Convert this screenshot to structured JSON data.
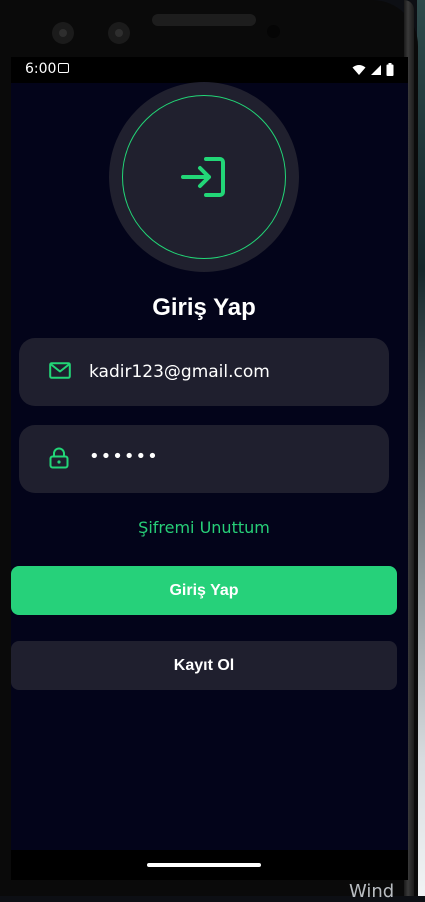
{
  "status_bar": {
    "time": "6:00",
    "icons": [
      "screenshot-icon",
      "wifi-icon",
      "signal-icon",
      "battery-icon"
    ]
  },
  "login": {
    "title": "Giriş Yap",
    "email_value": "kadir123@gmail.com",
    "password_masked": "••••••",
    "forgot_label": "Şifremi Unuttum",
    "login_button_label": "Giriş Yap",
    "register_button_label": "Kayıt Ol"
  },
  "background": {
    "watermark_text": "Wind"
  },
  "colors": {
    "accent": "#26d17a",
    "screen_bg": "#03041a",
    "surface": "#1f1f2e",
    "text": "#ffffff"
  }
}
